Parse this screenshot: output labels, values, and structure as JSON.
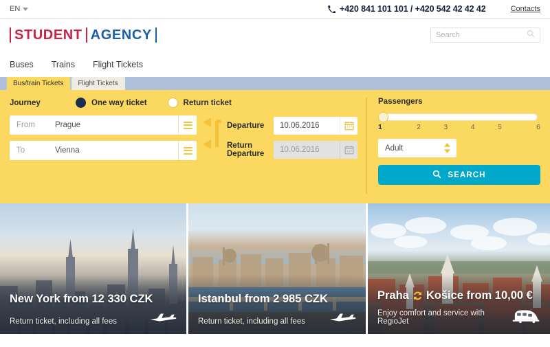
{
  "topbar": {
    "language": "EN",
    "language_caret_icon": "chevron-down-icon",
    "phone_icon": "phone-icon",
    "phone": "+420 841 101 101 / +420 542 42 42 42",
    "contacts_label": "Contacts"
  },
  "logo": {
    "word1": "STUDENT",
    "word2": "AGENCY",
    "color1": "#cc2243",
    "color2": "#1b5fa8"
  },
  "search": {
    "placeholder": "Search",
    "icon": "magnifier-icon"
  },
  "nav": {
    "items": [
      {
        "label": "Buses"
      },
      {
        "label": "Trains"
      },
      {
        "label": "Flight Tickets"
      }
    ]
  },
  "tabs": [
    {
      "label": "Bus/train Tickets",
      "active": true
    },
    {
      "label": "Flight Tickets",
      "active": false
    }
  ],
  "booking": {
    "journey_label": "Journey",
    "options": [
      {
        "label": "One way ticket",
        "selected": true
      },
      {
        "label": "Return ticket",
        "selected": false
      }
    ],
    "from": {
      "label": "From",
      "value": "Prague",
      "list_icon": "list-menu-icon"
    },
    "to": {
      "label": "To",
      "value": "Vienna",
      "list_icon": "list-menu-icon"
    },
    "swap_icon": "swap-direction-icon",
    "departure": {
      "label": "Departure",
      "value": "10.06.2016",
      "calendar_icon": "calendar-icon",
      "disabled": false
    },
    "return_departure": {
      "label": "Return Departure",
      "label_line1": "Return",
      "label_line2": "Departure",
      "value": "10.06.2016",
      "calendar_icon": "calendar-icon",
      "disabled": true
    },
    "passengers": {
      "label": "Passengers",
      "slider_value": 1,
      "slider_min": 1,
      "slider_max": 6,
      "ticks": [
        "1",
        "2",
        "3",
        "4",
        "5",
        "6"
      ],
      "type_value": "Adult",
      "stepper_icon": "up-down-arrows-icon"
    },
    "search_button": {
      "label": "SEARCH",
      "icon": "magnifier-icon",
      "color": "#00a9c9"
    },
    "panel_color": "#fbd961"
  },
  "cards": [
    {
      "title": "New York from 12 330 CZK",
      "subtitle": "Return ticket, including all fees",
      "glyph": "airplane-icon",
      "swap_icon": null
    },
    {
      "title": "Istanbul from 2 985 CZK",
      "subtitle": "Return ticket, including all fees",
      "glyph": "airplane-icon",
      "swap_icon": null
    },
    {
      "title_part1": "Praha",
      "title_part2": "Košice from 10,00 €",
      "title": "Praha ⟳ Košice from 10,00 €",
      "subtitle": "Enjoy comfort and service with RegioJet",
      "glyph": "train-icon",
      "swap_icon": "round-trip-icon",
      "swap_icon_color": "#f4c430"
    }
  ]
}
